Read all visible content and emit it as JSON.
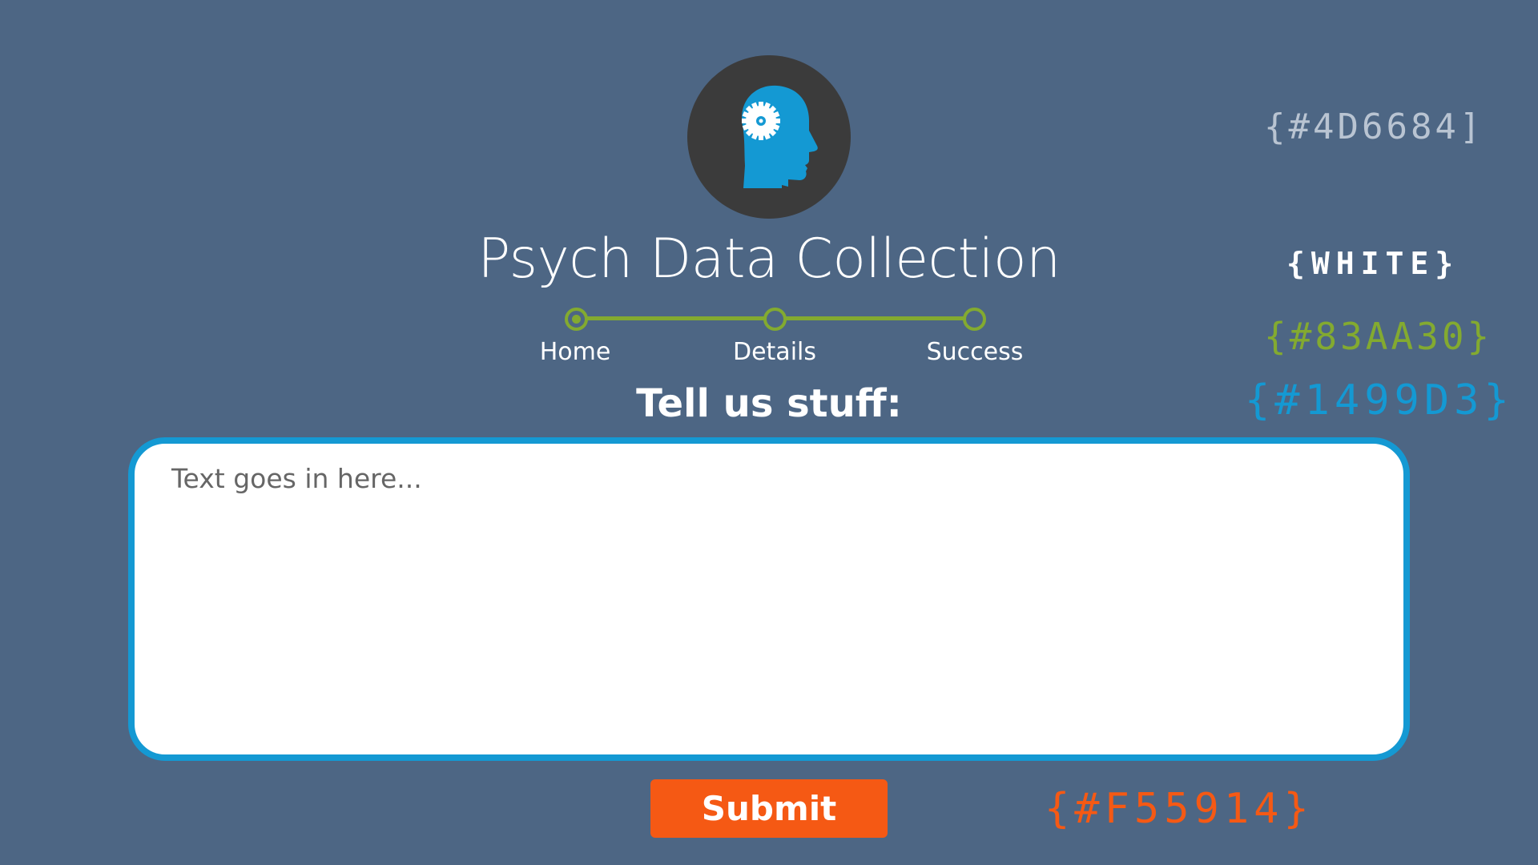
{
  "app": {
    "title": "Psych Data Collection",
    "logo_icon": "head-gear-icon"
  },
  "progress": {
    "steps": [
      {
        "label": "Home",
        "state": "active"
      },
      {
        "label": "Details",
        "state": "pending"
      },
      {
        "label": "Success",
        "state": "pending"
      }
    ]
  },
  "form": {
    "prompt": "Tell us stuff:",
    "textarea_value": "",
    "textarea_placeholder": "Text goes in here...",
    "submit_label": "Submit"
  },
  "swatches": {
    "background": "{#4D6684]",
    "white": "{WHITE}",
    "green": "{#83AA30}",
    "blue": "{#1499D3}",
    "orange": "{#F55914}"
  },
  "colors": {
    "background": "#4d6684",
    "white": "#ffffff",
    "green": "#83aa30",
    "blue": "#1499d3",
    "orange": "#f55914",
    "logo_circle": "#3b3b3b"
  }
}
